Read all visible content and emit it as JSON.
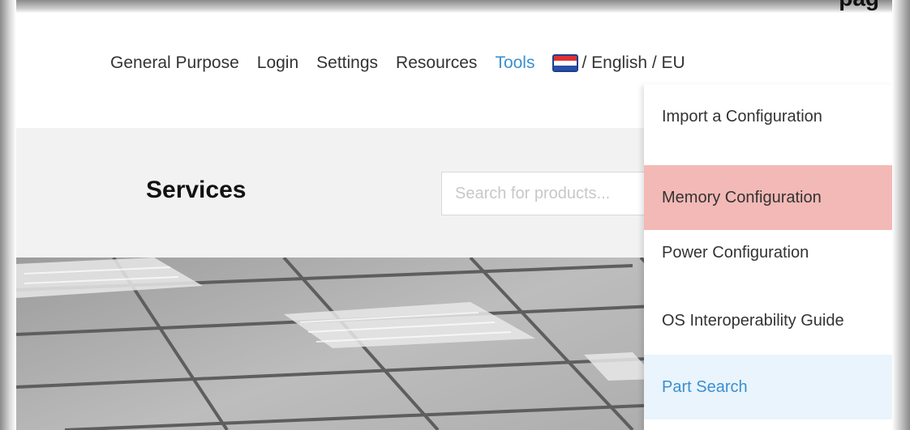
{
  "header": {
    "corner_text": "pag"
  },
  "nav": {
    "items": [
      {
        "label": "General Purpose"
      },
      {
        "label": "Login"
      },
      {
        "label": "Settings"
      },
      {
        "label": "Resources"
      },
      {
        "label": "Tools"
      }
    ],
    "active": "Tools",
    "language": {
      "flag": "netherlands-flag-icon",
      "label": "/ English / EU"
    }
  },
  "page": {
    "title": "Services"
  },
  "search": {
    "placeholder": "Search for products...",
    "value": ""
  },
  "tools_menu": {
    "items": [
      {
        "label": "Import a Configuration",
        "state": "normal"
      },
      {
        "label": "Memory Configuration",
        "state": "highlighted"
      },
      {
        "label": "Power Configuration",
        "state": "normal"
      },
      {
        "label": "OS Interoperability Guide",
        "state": "normal"
      },
      {
        "label": "Part Search",
        "state": "hover"
      }
    ]
  },
  "colors": {
    "accent": "#3a8fd0",
    "highlight": "#f3b9b6",
    "hover_bg": "#e9f4fc",
    "band": "#f2f2f2"
  }
}
